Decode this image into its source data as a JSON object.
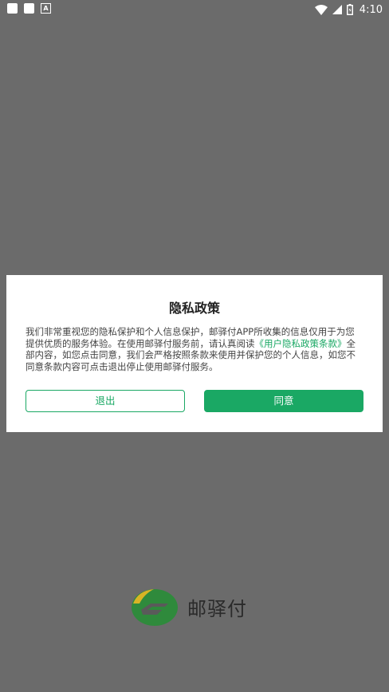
{
  "status_bar": {
    "time": "4:10",
    "notification_letter": "A"
  },
  "dialog": {
    "title": "隐私政策",
    "body_before": "我们非常重视您的隐私保护和个人信息保护，邮驿付APP所收集的信息仅用于为您提供优质的服务体验。在使用邮驿付服务前，请认真阅读",
    "policy_link": "《用户隐私政策条款》",
    "body_after": "全部内容，如您点击同意，我们会严格按照条款来使用并保护您的个人信息，如您不同意条款内容可点击退出停止使用邮驿付服务。",
    "exit_label": "退出",
    "agree_label": "同意"
  },
  "brand": {
    "name": "邮驿付"
  },
  "colors": {
    "accent": "#1aa864",
    "overlay": "#6b6b6b",
    "logo_green": "#2f8a3c",
    "logo_yellow": "#d8b425"
  }
}
